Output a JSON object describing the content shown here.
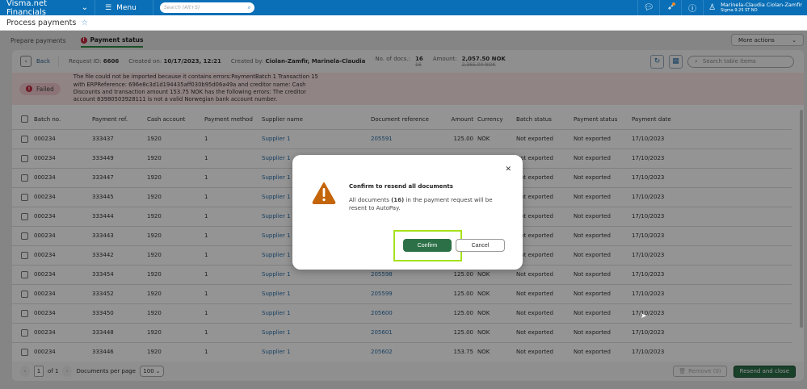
{
  "topbar": {
    "brand": "Visma.net Financials",
    "menu": "Menu",
    "search_placeholder": "Search (Alt+S)",
    "user_name": "Marinela-Claudia Ciolan-Zamfir",
    "company": "Sigma 9.25 ST NO"
  },
  "page": {
    "title": "Process payments"
  },
  "tabs": [
    {
      "label": "Prepare payments"
    },
    {
      "label": "Payment status"
    }
  ],
  "more_actions": "More actions",
  "info": {
    "back": "Back",
    "request_id_label": "Request ID:",
    "request_id": "6606",
    "created_on_label": "Created on:",
    "created_on": "10/17/2023, 12:21",
    "created_by_label": "Created by:",
    "created_by": "Ciolan-Zamfir, Marinela-Claudia",
    "docs_label": "No. of docs.:",
    "docs": "16",
    "docs_old": "16",
    "amount_label": "Amount:",
    "amount": "2,057.50 NOK",
    "amount_old": "2,365.00 NOK",
    "search_placeholder": "Search table items"
  },
  "error": {
    "status": "Failed",
    "message": "The file could not be imported because it contains errors:PaymentBatch 1 Transaction 15 with ERPReference: 696e8c3d1d194435aff030b95d06a49a and creditor name: Cash Discounts and transaction amount 153.75 NOK has the following errors: The creditor account 83980503928111 is not a valid Norwegian bank account number."
  },
  "table": {
    "columns": [
      "Batch no.",
      "Payment ref.",
      "Cash account",
      "Payment method",
      "Supplier name",
      "Document reference",
      "Amount",
      "Currency",
      "Batch status",
      "Payment status",
      "Payment date"
    ],
    "rows": [
      [
        "000234",
        "333437",
        "1920",
        "1",
        "Supplier 1",
        "205591",
        "125.00",
        "NOK",
        "Not exported",
        "Not exported",
        "17/10/2023"
      ],
      [
        "000234",
        "333449",
        "1920",
        "1",
        "Supplier 1",
        "",
        "",
        "",
        "Not exported",
        "Not exported",
        "17/10/2023"
      ],
      [
        "000234",
        "333447",
        "1920",
        "1",
        "Supplier 1",
        "",
        "",
        "",
        "Not exported",
        "Not exported",
        "17/10/2023"
      ],
      [
        "000234",
        "333445",
        "1920",
        "1",
        "Supplier 1",
        "",
        "",
        "",
        "Not exported",
        "Not exported",
        "17/10/2023"
      ],
      [
        "000234",
        "333444",
        "1920",
        "1",
        "Supplier 1",
        "",
        "",
        "",
        "Not exported",
        "Not exported",
        "17/10/2023"
      ],
      [
        "000234",
        "333443",
        "1920",
        "1",
        "Supplier 1",
        "",
        "",
        "",
        "Not exported",
        "Not exported",
        "17/10/2023"
      ],
      [
        "000234",
        "333442",
        "1920",
        "1",
        "Supplier 1",
        "",
        "",
        "",
        "Not exported",
        "Not exported",
        "17/10/2023"
      ],
      [
        "000234",
        "333454",
        "1920",
        "1",
        "Supplier 1",
        "205598",
        "125.00",
        "NOK",
        "Not exported",
        "Not exported",
        "17/10/2023"
      ],
      [
        "000234",
        "333452",
        "1920",
        "1",
        "Supplier 1",
        "205599",
        "125.00",
        "NOK",
        "Not exported",
        "Not exported",
        "17/10/2023"
      ],
      [
        "000234",
        "333450",
        "1920",
        "1",
        "Supplier 1",
        "205600",
        "125.00",
        "NOK",
        "Not exported",
        "Not exported",
        "17/10/2023"
      ],
      [
        "000234",
        "333448",
        "1920",
        "1",
        "Supplier 1",
        "205601",
        "125.00",
        "NOK",
        "Not exported",
        "Not exported",
        "17/10/2023"
      ],
      [
        "000234",
        "333446",
        "1920",
        "1",
        "Supplier 1",
        "205602",
        "153.75",
        "NOK",
        "Not exported",
        "Not exported",
        "17/10/2023"
      ]
    ]
  },
  "footer": {
    "page": "1",
    "of": "of 1",
    "per_page_label": "Documents per page",
    "per_page": "100",
    "remove": "Remove (0)",
    "resend": "Resend and close"
  },
  "modal": {
    "title": "Confirm to resend all documents",
    "body_pre": "All documents ",
    "count": "(16)",
    "body_post": " in the payment request will be resent to AutoPay.",
    "confirm": "Confirm",
    "cancel": "Cancel"
  },
  "colors": {
    "brand": "#0a6fb6",
    "primary": "#2b7046",
    "warning": "#c4650a",
    "highlight": "#a5e21c",
    "error": "#c0263d"
  }
}
